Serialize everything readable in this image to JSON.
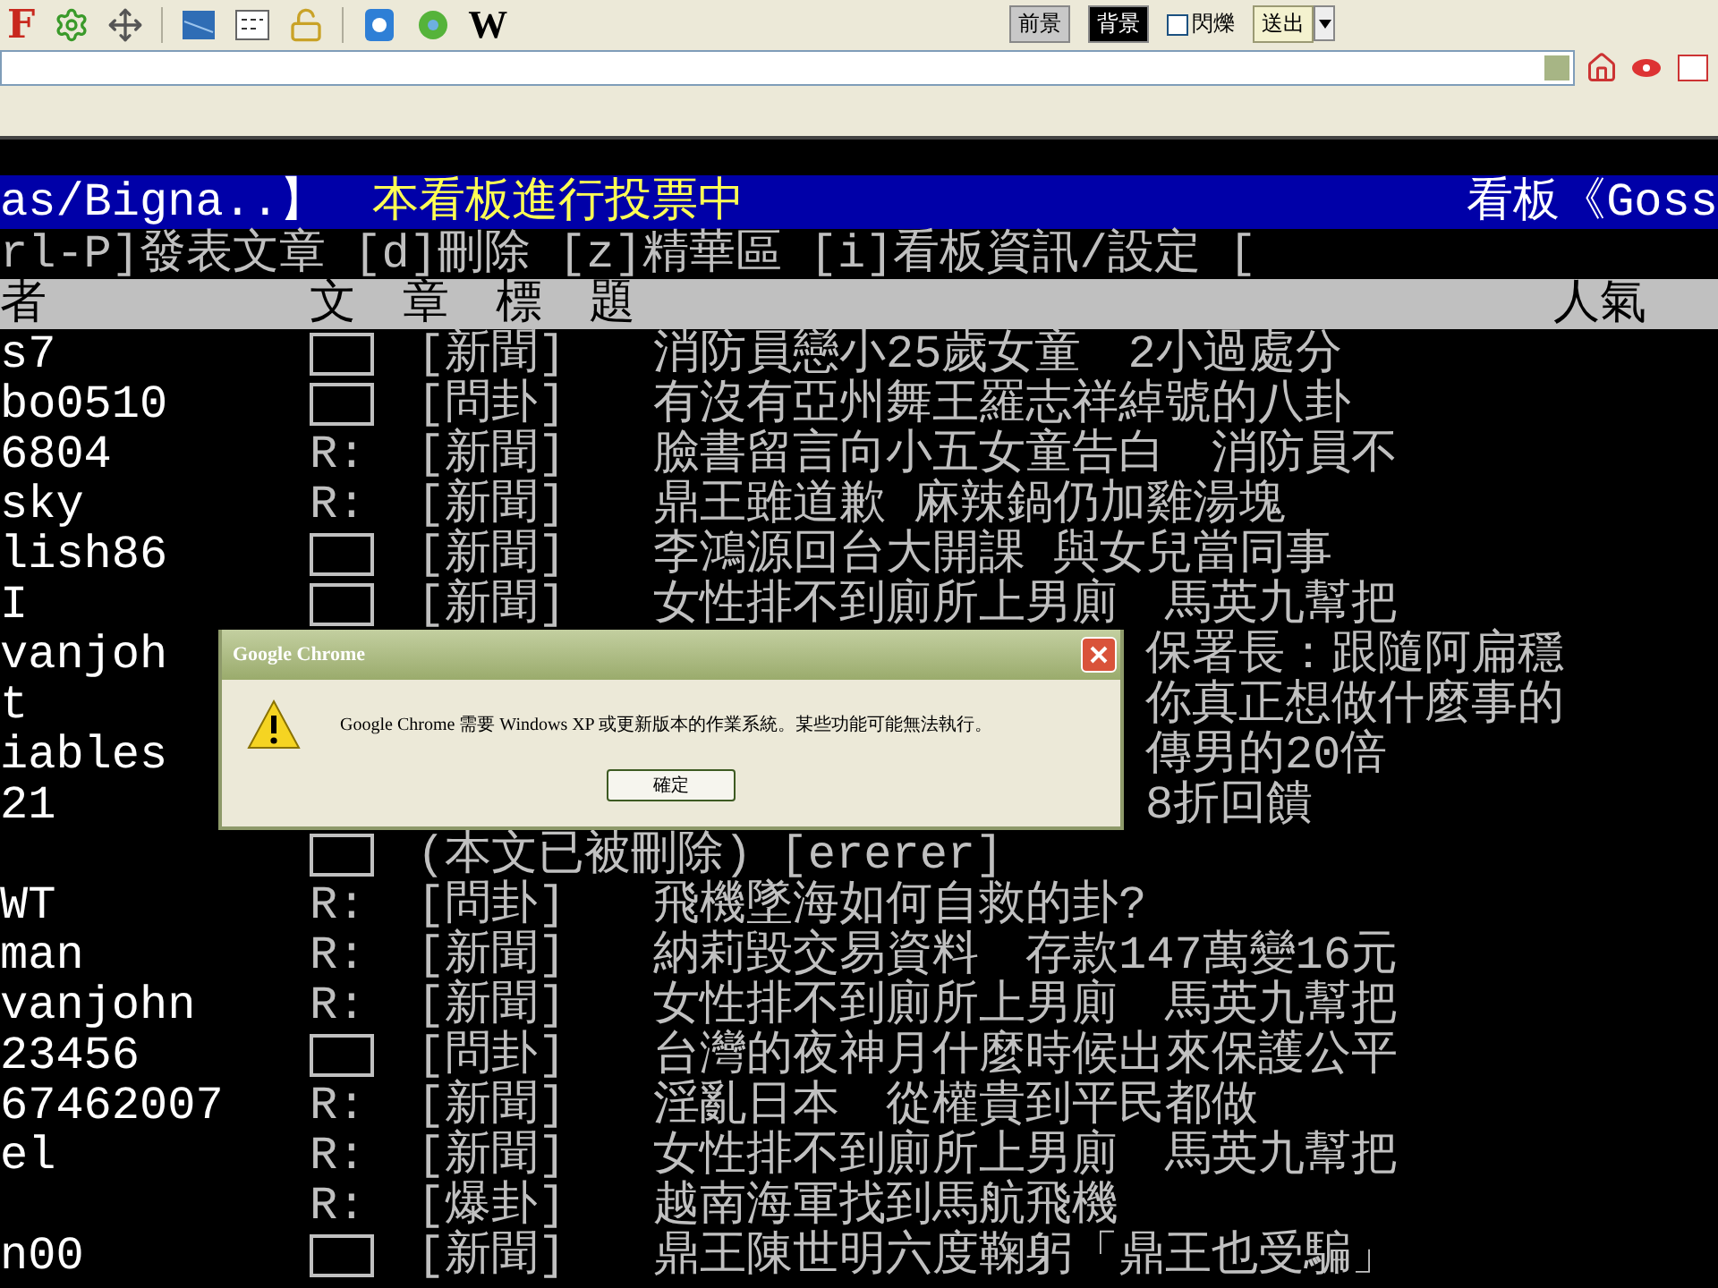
{
  "toolbar": {
    "logo_letter": "F",
    "wiki_letter": "W",
    "color_buttons": [
      {
        "label": "前景",
        "selected": false
      },
      {
        "label": "背景",
        "selected": true
      }
    ],
    "blink": {
      "label": "閃爍",
      "checked": false
    },
    "send_button": "送出"
  },
  "terminal": {
    "board_path": "as/Bigna..】",
    "vote_notice": "本看板進行投票中",
    "board_name": "看板《Goss",
    "command_line": "rl-P]發表文章 [d]刪除 [z]精華區 [i]看板資訊/設定 [",
    "header": {
      "author": "者",
      "title": "文　章　標　題",
      "popularity": "人氣"
    },
    "rows": [
      {
        "kind": "post",
        "author": "s7",
        "category": "[新聞]",
        "title": "消防員戀小25歲女童　2小過處分"
      },
      {
        "kind": "post",
        "author": "bo0510",
        "category": "[問卦]",
        "title": "有沒有亞州舞王羅志祥綽號的八卦"
      },
      {
        "kind": "reply",
        "author": "6804",
        "mark": "R:",
        "category": "[新聞]",
        "title": "臉書留言向小五女童告白　消防員不"
      },
      {
        "kind": "reply",
        "author": "sky",
        "mark": "R:",
        "category": "[新聞]",
        "title": "鼎王雖道歉 麻辣鍋仍加雞湯塊"
      },
      {
        "kind": "post",
        "author": "lish86",
        "category": "[新聞]",
        "title": "李鴻源回台大開課 與女兒當同事"
      },
      {
        "kind": "post",
        "author": "I",
        "category": "[新聞]",
        "title": "女性排不到廁所上男廁　馬英九幫把"
      },
      {
        "kind": "covered",
        "author": "vanjoh",
        "title": "保署長：跟隨阿扁穩"
      },
      {
        "kind": "covered",
        "author": "t",
        "title": "你真正想做什麼事的"
      },
      {
        "kind": "covered",
        "author": "iables",
        "title": "傳男的20倍"
      },
      {
        "kind": "covered",
        "author": "21",
        "title": "8折回饋"
      },
      {
        "kind": "deleted",
        "note": "(本文已被刪除) [ererer]"
      },
      {
        "kind": "reply",
        "author": "WT",
        "mark": "R:",
        "category": "[問卦]",
        "title": "飛機墜海如何自救的卦?"
      },
      {
        "kind": "reply",
        "author": "man",
        "mark": "R:",
        "category": "[新聞]",
        "title": "納莉毀交易資料　存款147萬變16元"
      },
      {
        "kind": "reply",
        "author": "vanjohn",
        "mark": "R:",
        "category": "[新聞]",
        "title": "女性排不到廁所上男廁　馬英九幫把"
      },
      {
        "kind": "post",
        "author": "23456",
        "category": "[問卦]",
        "title": "台灣的夜神月什麼時候出來保護公平"
      },
      {
        "kind": "reply",
        "author": "67462007",
        "mark": "R:",
        "category": "[新聞]",
        "title": "淫亂日本　從權貴到平民都做"
      },
      {
        "kind": "reply",
        "author": "el",
        "mark": "R:",
        "category": "[新聞]",
        "title": "女性排不到廁所上男廁　馬英九幫把"
      },
      {
        "kind": "reply",
        "mark": "R:",
        "category": "[爆卦]",
        "title": "越南海軍找到馬航飛機"
      },
      {
        "kind": "post",
        "author": "n00",
        "category": "[新聞]",
        "title": "鼎王陳世明六度鞠躬「鼎王也受騙」"
      }
    ]
  },
  "dialog": {
    "title": "Google Chrome",
    "message": "Google Chrome 需要 Windows XP 或更新版本的作業系統。某些功能可能無法執行。",
    "ok_button": "確定"
  }
}
